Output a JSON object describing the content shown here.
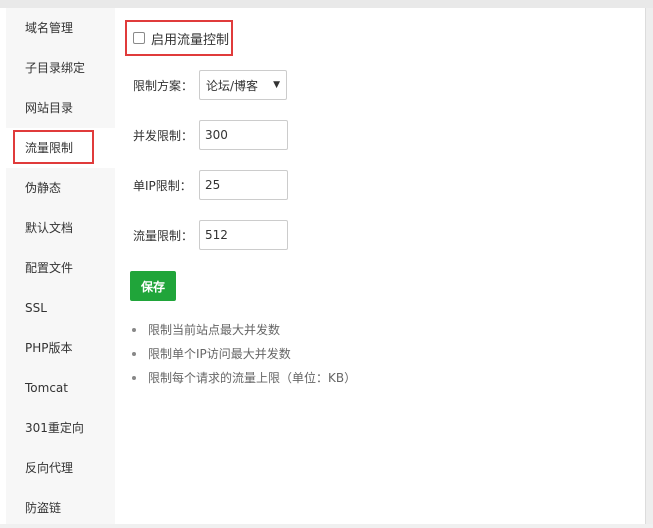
{
  "sidebar": {
    "items": [
      {
        "label": "域名管理"
      },
      {
        "label": "子目录绑定"
      },
      {
        "label": "网站目录"
      },
      {
        "label": "流量限制"
      },
      {
        "label": "伪静态"
      },
      {
        "label": "默认文档"
      },
      {
        "label": "配置文件"
      },
      {
        "label": "SSL"
      },
      {
        "label": "PHP版本"
      },
      {
        "label": "Tomcat"
      },
      {
        "label": "301重定向"
      },
      {
        "label": "反向代理"
      },
      {
        "label": "防盗链"
      }
    ],
    "active": "流量限制"
  },
  "main": {
    "enable_label": "启用流量控制",
    "enabled": false,
    "scheme_label": "限制方案：",
    "scheme_value": "论坛/博客",
    "concurrency_label": "并发限制：",
    "concurrency_value": "300",
    "single_ip_label": "单IP限制：",
    "single_ip_value": "25",
    "traffic_label": "流量限制：",
    "traffic_value": "512",
    "save_label": "保存",
    "tips": [
      "限制当前站点最大并发数",
      "限制单个IP访问最大并发数",
      "限制每个请求的流量上限（单位：KB）"
    ]
  },
  "colors": {
    "accent_green": "#20a53a",
    "highlight_red": "#e03b3b"
  }
}
